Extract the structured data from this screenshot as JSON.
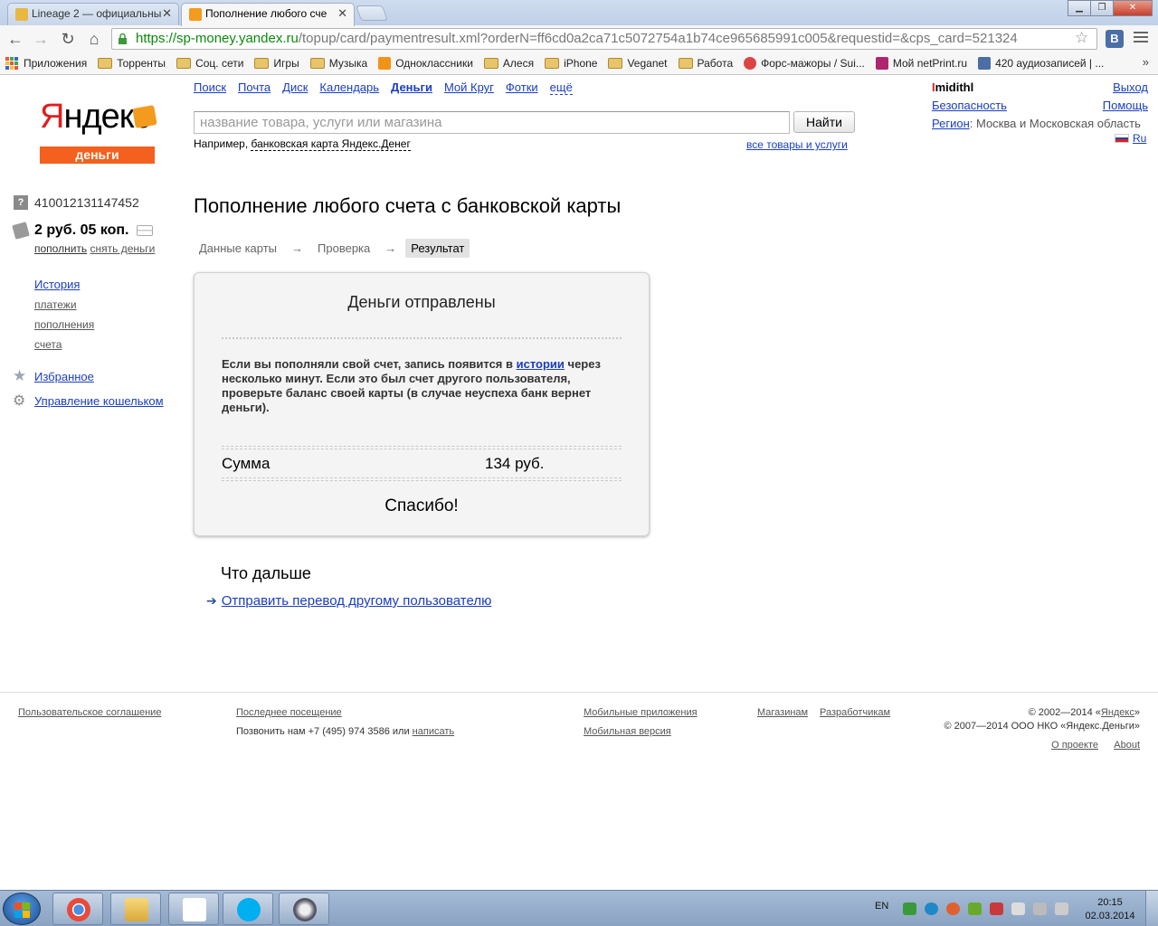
{
  "browser": {
    "tabs": [
      {
        "title": "Lineage 2 — официальны",
        "active": false
      },
      {
        "title": "Пополнение любого сче",
        "active": true
      }
    ],
    "url_scheme": "https://",
    "url_host": "sp-money.yandex.ru",
    "url_rest": "/topup/card/paymentresult.xml?orderN=ff6cd0a2ca71c5072754a1b74ce965685991c005&requestid=&cps_card=521324",
    "extension_label": "B",
    "bookmarks": [
      "Приложения",
      "Торренты",
      "Соц. сети",
      "Игры",
      "Музыка",
      "Одноклассники",
      "Алеся",
      "iPhone",
      "Veganet",
      "Работа",
      "Форс-мажоры / Sui...",
      "Мой netPrint.ru",
      "420 аудиозаписей | ..."
    ]
  },
  "header": {
    "logo_ya": "Я",
    "logo_rest": "ндекс",
    "logo_sub": "деньги",
    "nav": [
      "Поиск",
      "Почта",
      "Диск",
      "Календарь",
      "Деньги",
      "Мой Круг",
      "Фотки",
      "ещё"
    ],
    "search_placeholder": "название товара, услуги или магазина",
    "search_button": "Найти",
    "example_prefix": "Например, ",
    "example_link": "банковская карта Яндекс.Денег",
    "all_goods": "все товары и услуги",
    "user_first": "I",
    "user_rest": "midithl",
    "exit": "Выход",
    "security": "Безопасность",
    "help": "Помощь",
    "region_label": "Регион",
    "region_value": ": Москва и Московская область",
    "lang": "Ru"
  },
  "sidebar": {
    "account": "410012131147452",
    "balance": "2 руб. 05 коп.",
    "topup": "пополнить",
    "withdraw": "снять деньги",
    "history": "История",
    "history_items": [
      "платежи",
      "пополнения",
      "счета"
    ],
    "favorites": "Избранное",
    "wallet_mgmt": "Управление кошельком"
  },
  "main": {
    "title": "Пополнение любого счета с банковской карты",
    "steps": [
      "Данные карты",
      "Проверка",
      "Результат"
    ],
    "step_arrow": "→",
    "box_title": "Деньги отправлены",
    "msg_before": "Если вы пополняли свой счет, запись появится в ",
    "msg_link": "истории",
    "msg_after": " через несколько минут. Если это был счет другого пользователя, проверьте баланс своей карты (в случае неуспеха банк вернет деньги).",
    "sum_label": "Сумма",
    "sum_value": "134 руб.",
    "thanks": "Спасибо!",
    "next_heading": "Что дальше",
    "next_link": "Отправить перевод другому пользователю"
  },
  "footer": {
    "agreement": "Пользовательское соглашение",
    "last_visit": "Последнее посещение",
    "call_prefix": "Позвонить нам +7 (495) 974 3586 или ",
    "write": "написать",
    "mobile_apps": "Мобильные приложения",
    "mobile_version": "Мобильная версия",
    "shops": "Магазинам",
    "developers": "Разработчикам",
    "copyright1_prefix": "© 2002—2014 «",
    "copyright1_link": "Яндекс",
    "copyright1_suffix": "»",
    "copyright2": "© 2007—2014 ООО НКО «Яндекс.Деньги»",
    "about_ru": "О проекте",
    "about_en": "About"
  },
  "taskbar": {
    "lang": "EN",
    "time": "20:15",
    "date": "02.03.2014"
  },
  "colors": {
    "yandex_red": "#e21d1d",
    "money_orange": "#f4601d",
    "link_blue": "#1a3dc1",
    "url_green": "#0a8a0a"
  }
}
